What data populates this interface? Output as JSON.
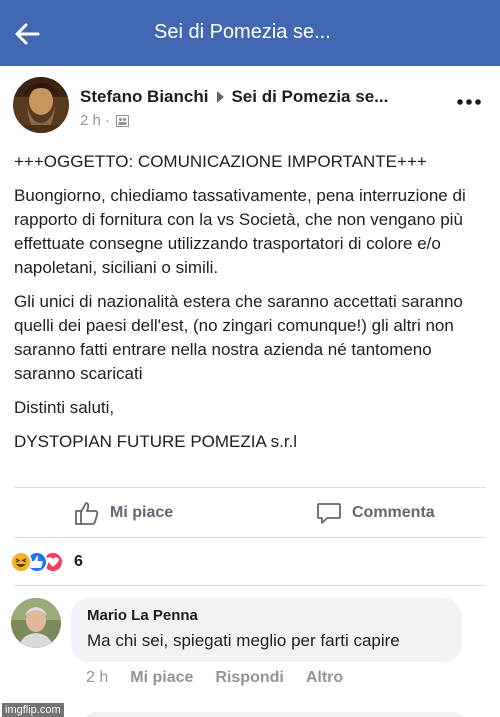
{
  "header": {
    "title": "Sei di Pomezia se..."
  },
  "post": {
    "author": "Stefano Bianchi",
    "group": "Sei di Pomezia se...",
    "time": "2 h",
    "paragraphs": [
      "+++OGGETTO: COMUNICAZIONE IMPORTANTE+++",
      "Buongiorno, chiediamo tassativamente, pena interruzione di rapporto di fornitura con la vs Società, che non vengano più effettuate consegne utilizzando trasportatori di colore e/o napoletani, siciliani o simili.",
      "Gli unici di nazionalità estera che saranno accettati saranno quelli dei paesi dell'est, (no zingari comunque!) gli altri non saranno fatti entrare nella nostra azienda né tantomeno saranno scaricati",
      "Distinti saluti,",
      "DYSTOPIAN FUTURE POMEZIA s.r.l"
    ]
  },
  "actions": {
    "like": "Mi piace",
    "comment": "Commenta"
  },
  "reactions": {
    "count": "6",
    "icons": [
      "haha-icon",
      "like-icon",
      "love-icon"
    ],
    "colors": {
      "haha": "#f7b125",
      "like": "#1877f2",
      "love": "#f33e58"
    }
  },
  "comment": {
    "author": "Mario La Penna",
    "text": "Ma chi sei, spiegati meglio per farti capire",
    "time": "2 h",
    "like": "Mi piace",
    "reply": "Rispondi",
    "other": "Altro"
  },
  "watermark": "imgflip.com",
  "colors": {
    "header": "#4267b2",
    "background": "#ffffff",
    "bubble": "#f0f2f5"
  }
}
